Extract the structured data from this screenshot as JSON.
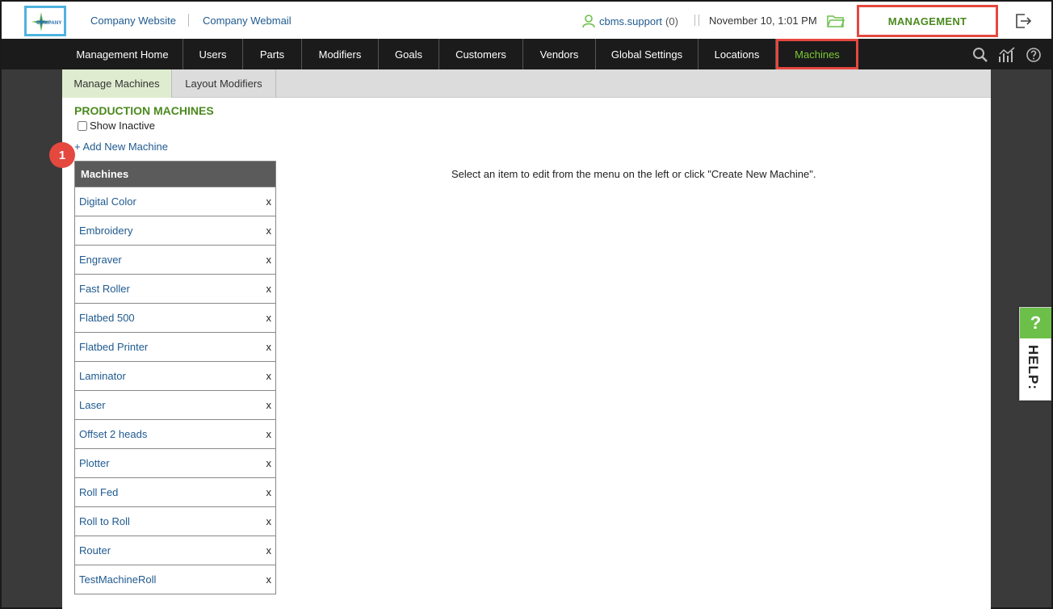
{
  "header": {
    "logo_text": "COMPANY",
    "links": [
      "Company Website",
      "Company Webmail"
    ],
    "user_name": "cbms.support",
    "user_count": "(0)",
    "datetime": "November 10, 1:01 PM",
    "management_label": "MANAGEMENT"
  },
  "nav": {
    "items": [
      "Management Home",
      "Users",
      "Parts",
      "Modifiers",
      "Goals",
      "Customers",
      "Vendors",
      "Global Settings",
      "Locations",
      "Machines"
    ],
    "active": "Machines"
  },
  "subtabs": [
    "Manage Machines",
    "Layout Modifiers"
  ],
  "section": {
    "title": "PRODUCTION MACHINES",
    "show_inactive_label": "Show Inactive",
    "add_label": "+ Add New Machine",
    "badge": "1"
  },
  "machines": {
    "header": "Machines",
    "delete_label": "x",
    "items": [
      "Digital Color",
      "Embroidery",
      "Engraver",
      "Fast Roller",
      "Flatbed 500",
      "Flatbed Printer",
      "Laminator",
      "Laser",
      "Offset 2 heads",
      "Plotter",
      "Roll Fed",
      "Roll to Roll",
      "Router",
      "TestMachineRoll"
    ]
  },
  "hint": "Select an item to edit from the menu on the left or click \"Create New Machine\".",
  "help": {
    "q": "?",
    "label": "HELP:"
  },
  "colors": {
    "accent_green": "#4b8a1e",
    "highlight_red": "#e5483f",
    "link_blue": "#1f5a8f",
    "nav_bg": "#1b1b1b"
  }
}
